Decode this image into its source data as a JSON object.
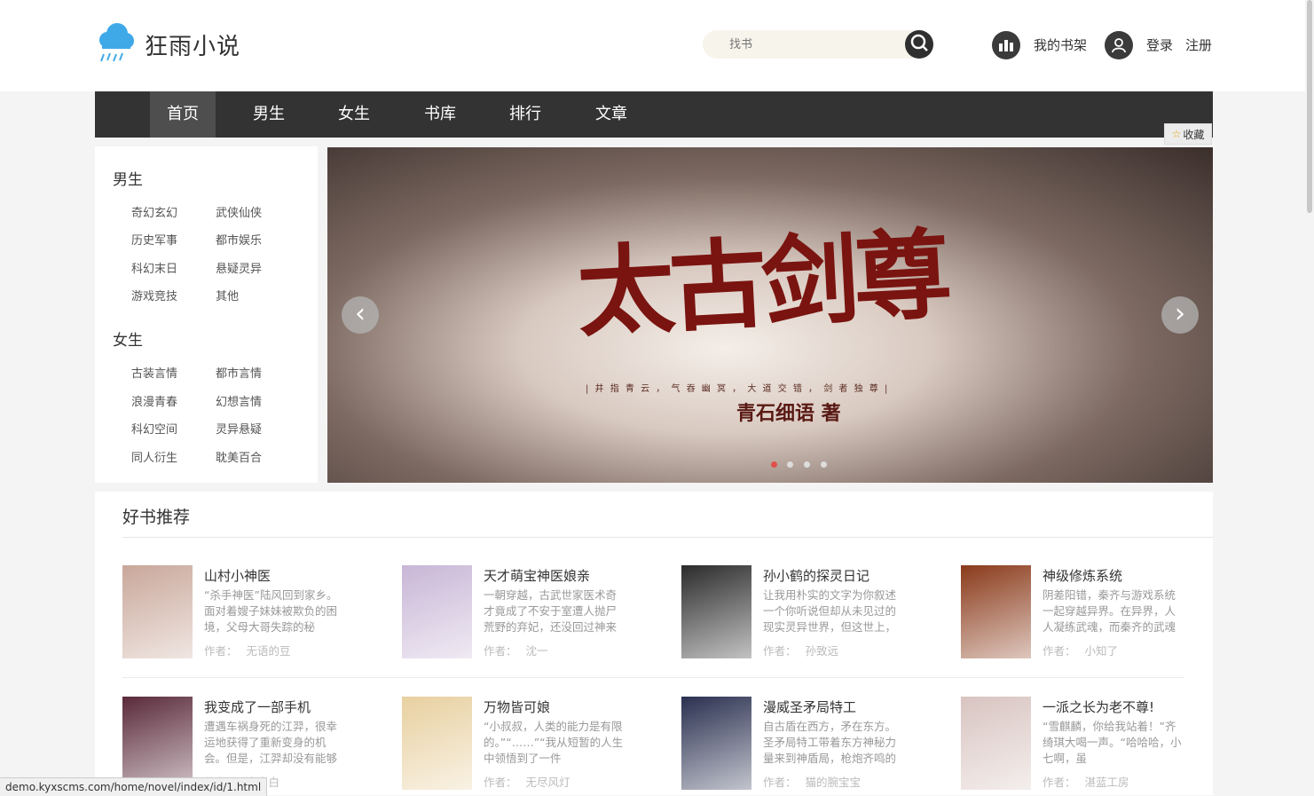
{
  "header": {
    "site_name": "狂雨小说",
    "search_placeholder": "找书",
    "bookshelf": "我的书架",
    "login": "登录",
    "register": "注册"
  },
  "nav": [
    "首页",
    "男生",
    "女生",
    "书库",
    "排行",
    "文章"
  ],
  "favorite": "收藏",
  "sidebar": {
    "male_title": "男生",
    "male": [
      "奇幻玄幻",
      "武侠仙侠",
      "历史军事",
      "都市娱乐",
      "科幻末日",
      "悬疑灵异",
      "游戏竞技",
      "其他"
    ],
    "female_title": "女生",
    "female": [
      "古装言情",
      "都市言情",
      "浪漫青春",
      "幻想言情",
      "科幻空间",
      "灵异悬疑",
      "同人衍生",
      "耽美百合"
    ]
  },
  "banner": {
    "title": "太古剑尊",
    "subtitle": "| 井 指 青 云 ， 气 吞 幽 冥 ， 大 道 交 错 ， 剑 者 独 尊 |",
    "author": "青石细语 著",
    "slide_count": 4,
    "active_slide": 1
  },
  "recommend": {
    "title": "好书推荐",
    "author_label": "作者：",
    "books": [
      {
        "title": "山村小神医",
        "desc": "“杀手神医”陆风回到家乡。面对着嫂子妹妹被欺负的困境，父母大哥失踪的秘",
        "author": "无语的豆",
        "color": "#c9a79a"
      },
      {
        "title": "天才萌宝神医娘亲",
        "desc": "一朝穿越，古武世家医术奇才竟成了不安于室遭人抛尸荒野的弃妃，还没回过神来",
        "author": "沈一",
        "color": "#c8b6d6"
      },
      {
        "title": "孙小鹤的探灵日记",
        "desc": "让我用朴实的文字为你叙述一个你听说但却从未见过的现实灵异世界，但这世上，",
        "author": "孙致远",
        "color": "#2b2b2b"
      },
      {
        "title": "神级修炼系统",
        "desc": "阴差阳错，秦齐与游戏系统一起穿越异界。在异界，人人凝练武魂，而秦齐的武魂",
        "author": "小知了",
        "color": "#8a3a1a"
      },
      {
        "title": "我变成了一部手机",
        "desc": "遭遇车祸身死的江羿，很幸运地获得了重新变身的机会。但是，江羿却没有能够",
        "author": "李白白",
        "color": "#5a2a3a"
      },
      {
        "title": "万物皆可娘",
        "desc": "“小叔叔，人类的能力是有限的。”“……”“我从短暂的人生中领悟到了一件",
        "author": "无尽风灯",
        "color": "#e8d0a0"
      },
      {
        "title": "漫威圣矛局特工",
        "desc": "自古盾在西方，矛在东方。圣矛局特工带着东方神秘力量来到神盾局，枪炮齐鸣的",
        "author": "猫的腕宝宝",
        "color": "#2a3050"
      },
      {
        "title": "一派之长为老不尊!",
        "desc": "“雪麒麟，你给我站着！”齐绮琪大喝一声。“哈哈哈，小七啊，虽",
        "author": "湛蓝工房",
        "color": "#d8c4c0"
      }
    ]
  },
  "status_url": "demo.kyxscms.com/home/novel/index/id/1.html"
}
